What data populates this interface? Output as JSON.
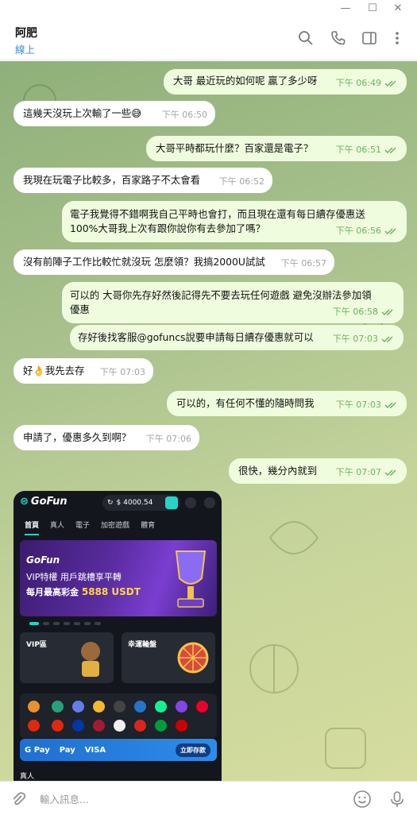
{
  "window": {
    "controls": [
      "minimize",
      "maximize",
      "close"
    ]
  },
  "header": {
    "title": "阿肥",
    "status": "線上",
    "icons": [
      "search-icon",
      "phone-icon",
      "sidebar-toggle-icon",
      "more-icon"
    ]
  },
  "colors": {
    "accent": "#3a8ed8",
    "outgoing_bubble": "#effdde",
    "incoming_bubble": "#ffffff",
    "check": "#6bb35e"
  },
  "messages": [
    {
      "dir": "out",
      "text": "大哥 最近玩的如何呢 贏了多少呀",
      "time": "下午 06:49",
      "read": true
    },
    {
      "dir": "in",
      "text": "這幾天沒玩上次輸了一些😅",
      "time": "下午 06:50"
    },
    {
      "dir": "out",
      "text": "大哥平時都玩什麼？百家還是電子？",
      "time": "下午 06:51",
      "read": true
    },
    {
      "dir": "in",
      "text": "我現在玩電子比較多，百家路子不太會看",
      "time": "下午 06:52"
    },
    {
      "dir": "out",
      "text": "電子我覺得不錯啊我自己平時也會打，而且現在還有每日續存優惠送\n100%大哥我上次有跟你說你有去參加了嗎？",
      "time": "下午 06:56",
      "read": true
    },
    {
      "dir": "in",
      "text": "沒有前陣子工作比較忙就沒玩 怎麼領？我搞2000U試試",
      "time": "下午 06:57"
    },
    {
      "dir": "out",
      "text": "可以的 大哥你先存好然後記得先不要去玩任何遊戲 避免沒辦法參加領\n優惠",
      "time": "下午 06:58",
      "read": true
    },
    {
      "dir": "out",
      "text": "存好後找客服@gofuncs說要申請每日續存優惠就可以",
      "time": "下午 07:03",
      "read": true
    },
    {
      "dir": "in",
      "text": "好👌我先去存",
      "time": "下午 07:03"
    },
    {
      "dir": "out",
      "text": "可以的，有任何不懂的隨時問我",
      "time": "下午 07:03",
      "read": true
    },
    {
      "dir": "in",
      "text": "申請了，優惠多久到啊？",
      "time": "下午 07:06"
    },
    {
      "dir": "out",
      "text": "很快，幾分內就到",
      "time": "下午 07:07",
      "read": true
    }
  ],
  "media": {
    "app_name": "GoFun",
    "balance": "$ 4000.54",
    "tabs": [
      "首頁",
      "真人",
      "電子",
      "加密遊戲",
      "體育"
    ],
    "banner": {
      "logo": "GoFun",
      "line1": "VIP特權 用戶跳槽享平轉",
      "line2_prefix": "每月最高彩金",
      "line2_amount": "5888 USDT"
    },
    "carousel_dots": 7,
    "carousel_active": 0,
    "cards": [
      "VIP區",
      "幸運輪盤"
    ],
    "payment": {
      "methods": [
        "G Pay",
        "Pay",
        "VISA"
      ],
      "button": "立即存款"
    },
    "bottom_label": "真人"
  },
  "composer": {
    "placeholder": "輸入訊息..."
  }
}
